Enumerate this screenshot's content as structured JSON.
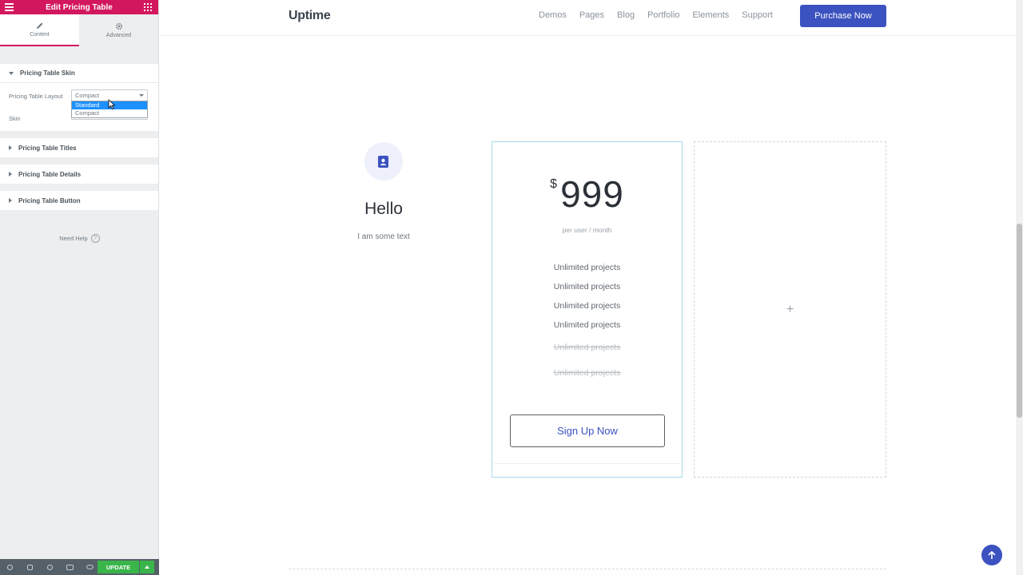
{
  "sidebar": {
    "title": "Edit Pricing Table",
    "tabs": [
      {
        "label": "Content",
        "icon": "pencil-icon"
      },
      {
        "label": "Advanced",
        "icon": "gear-icon"
      }
    ],
    "skin_section": {
      "title": "Pricing Table Skin",
      "layout_label": "Pricing Table Layout",
      "layout_value": "Compact",
      "layout_options": [
        "Standard",
        "Compact"
      ],
      "skin_label": "Skin"
    },
    "sections": [
      "Pricing Table Titles",
      "Pricing Table Details",
      "Pricing Table Button"
    ],
    "need_help": "Need Help",
    "need_help_icon": "?",
    "update_label": "UPDATE"
  },
  "nav": {
    "logo": "Uptime",
    "links": [
      "Demos",
      "Pages",
      "Blog",
      "Portfolio",
      "Elements",
      "Support"
    ],
    "purchase": "Purchase Now"
  },
  "feature": {
    "title": "Hello",
    "text": "I am some text"
  },
  "pricing": {
    "currency": "$",
    "amount": "999",
    "period": "per user / month",
    "features": [
      "Unlimited projects",
      "Unlimited projects",
      "Unlimited projects",
      "Unlimited projects"
    ],
    "disabled_features": [
      "Unlimited projects",
      "Unlimited projects"
    ],
    "button": "Sign Up Now"
  },
  "empty_column_icon": "+",
  "colors": {
    "editor_accent": "#d3175e",
    "brand": "#3b52c0",
    "update_green": "#39b54a"
  }
}
